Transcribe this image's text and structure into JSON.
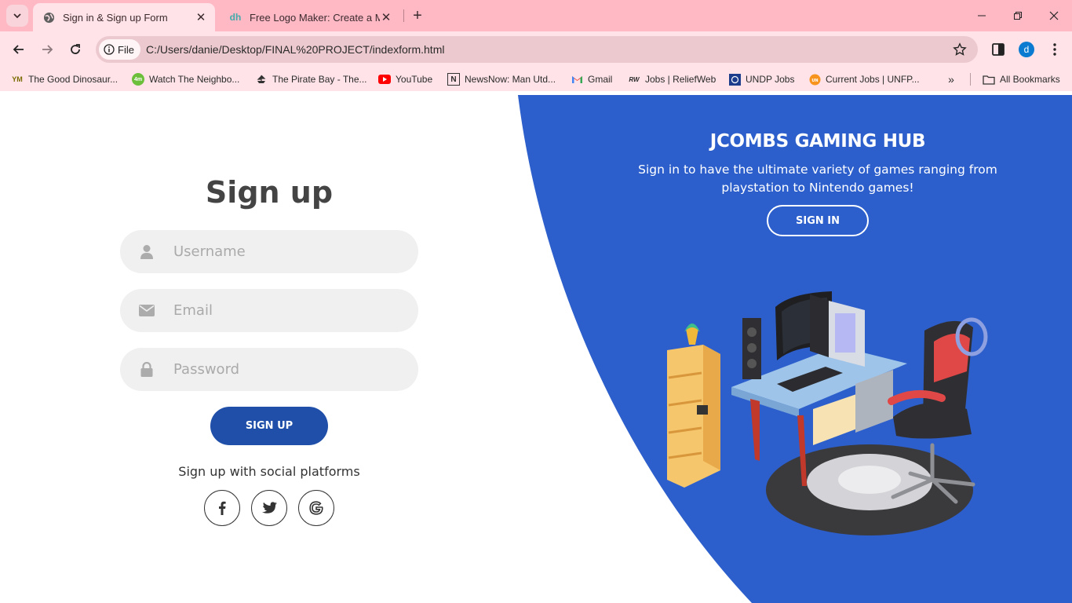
{
  "browser": {
    "tabs": [
      {
        "title": "Sign in & Sign up Form",
        "active": true
      },
      {
        "title": "Free Logo Maker: Create a Modern Logo",
        "active": false
      }
    ],
    "address": {
      "scheme_chip": "File",
      "url": "C:/Users/danie/Desktop/FINAL%20PROJECT/indexform.html"
    },
    "profile_initial": "d",
    "bookmarks": [
      {
        "label": "The Good Dinosaur...",
        "icon": "YM"
      },
      {
        "label": "Watch The Neighbo...",
        "icon": "4m"
      },
      {
        "label": "The Pirate Bay - The...",
        "icon": "pirate-ship-icon"
      },
      {
        "label": "YouTube",
        "icon": "youtube-icon"
      },
      {
        "label": "NewsNow: Man Utd...",
        "icon": "N"
      },
      {
        "label": "Gmail",
        "icon": "gmail-icon"
      },
      {
        "label": "Jobs | ReliefWeb",
        "icon": "RW"
      },
      {
        "label": "UNDP Jobs",
        "icon": "undp-icon"
      },
      {
        "label": "Current Jobs | UNFP...",
        "icon": "unfpa-icon"
      }
    ],
    "all_bookmarks": "All Bookmarks"
  },
  "signup": {
    "title": "Sign up",
    "username_placeholder": "Username",
    "email_placeholder": "Email",
    "password_placeholder": "Password",
    "button": "SIGN UP",
    "social_text": "Sign up with social platforms"
  },
  "panel": {
    "title": "JCOMBS GAMING HUB",
    "description": "Sign in to have the ultimate variety of games ranging from playstation to Nintendo games!",
    "button": "SIGN IN"
  },
  "colors": {
    "panel_blue": "#2c5fcc",
    "primary_button": "#1f4fa8",
    "tabstrip": "#ffb9c5",
    "toolbar": "#ffe3e8"
  }
}
